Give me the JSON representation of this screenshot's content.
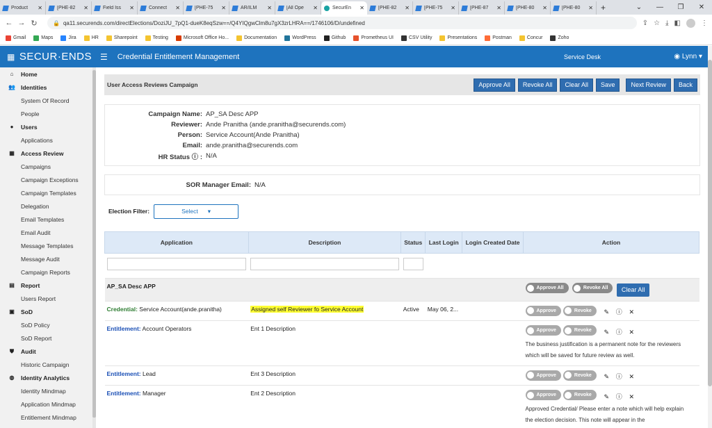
{
  "browser": {
    "tabs": [
      {
        "label": "Product"
      },
      {
        "label": "[PHE-82"
      },
      {
        "label": "Field Iss"
      },
      {
        "label": "Connect"
      },
      {
        "label": "[PHE-75"
      },
      {
        "label": "AR/ILM"
      },
      {
        "label": "[All Ope"
      },
      {
        "label": "SecurEn",
        "active": true
      },
      {
        "label": "[PHE-82"
      },
      {
        "label": "[PHE-75"
      },
      {
        "label": "[PHE-87"
      },
      {
        "label": "[PHE-80"
      },
      {
        "label": "[PHE-80"
      }
    ],
    "url": "qa11.securends.com/directElections/DoziJU_7pQ1-dueK8eqSzw==/Q4YIQgwClm8u7gX3zrLHRA==/1746106/D/undefined",
    "bookmarks": [
      {
        "label": "Gmail",
        "color": "#ea4335"
      },
      {
        "label": "Maps",
        "color": "#34a853"
      },
      {
        "label": "Jira",
        "color": "#2684ff"
      },
      {
        "label": "HR",
        "color": "#f4c430"
      },
      {
        "label": "Sharepoint",
        "color": "#f4c430"
      },
      {
        "label": "Testing",
        "color": "#f4c430"
      },
      {
        "label": "Microsoft Office Ho...",
        "color": "#d83b01"
      },
      {
        "label": "Documentation",
        "color": "#f4c430"
      },
      {
        "label": "WordPress",
        "color": "#21759b"
      },
      {
        "label": "Github",
        "color": "#222222"
      },
      {
        "label": "Prometheus UI",
        "color": "#e6522c"
      },
      {
        "label": "CSV Utility",
        "color": "#333333"
      },
      {
        "label": "Presentations",
        "color": "#f4c430"
      },
      {
        "label": "Postman",
        "color": "#ff6c37"
      },
      {
        "label": "Concur",
        "color": "#f4c430"
      },
      {
        "label": "Zoho",
        "color": "#333333"
      }
    ]
  },
  "header": {
    "logo": "SECUR·ENDS",
    "title": "Credential Entitlement Management",
    "service_desk": "Service Desk",
    "user": "Lynn",
    "accent": "#1e73be"
  },
  "sidebar": {
    "items": [
      {
        "label": "Home",
        "level": "top",
        "icon": "home-icon"
      },
      {
        "label": "Identities",
        "level": "top",
        "icon": "identities-icon"
      },
      {
        "label": "System Of Record",
        "level": "sub"
      },
      {
        "label": "People",
        "level": "sub"
      },
      {
        "label": "Users",
        "level": "top",
        "icon": "user-icon"
      },
      {
        "label": "Applications",
        "level": "sub"
      },
      {
        "label": "Access Review",
        "level": "top",
        "icon": "grid-icon"
      },
      {
        "label": "Campaigns",
        "level": "sub"
      },
      {
        "label": "Campaign Exceptions",
        "level": "sub"
      },
      {
        "label": "Campaign Templates",
        "level": "sub"
      },
      {
        "label": "Delegation",
        "level": "sub"
      },
      {
        "label": "Email Templates",
        "level": "sub"
      },
      {
        "label": "Email Audit",
        "level": "sub"
      },
      {
        "label": "Message Templates",
        "level": "sub"
      },
      {
        "label": "Message Audit",
        "level": "sub"
      },
      {
        "label": "Campaign Reports",
        "level": "sub"
      },
      {
        "label": "Report",
        "level": "top",
        "icon": "report-icon"
      },
      {
        "label": "Users Report",
        "level": "sub"
      },
      {
        "label": "SoD",
        "level": "top",
        "icon": "sod-icon"
      },
      {
        "label": "SoD Policy",
        "level": "sub"
      },
      {
        "label": "SoD Report",
        "level": "sub"
      },
      {
        "label": "Audit",
        "level": "top",
        "icon": "shield-icon"
      },
      {
        "label": "Historic Campaign",
        "level": "sub"
      },
      {
        "label": "Identity Analytics",
        "level": "top",
        "icon": "analytics-icon"
      },
      {
        "label": "Identity Mindmap",
        "level": "sub"
      },
      {
        "label": "Application Mindmap",
        "level": "sub"
      },
      {
        "label": "Entitlement Mindmap",
        "level": "sub"
      }
    ]
  },
  "toolbar": {
    "title": "User Access Reviews Campaign",
    "buttons": [
      "Approve All",
      "Revoke All",
      "Clear All",
      "Save",
      "Next Review",
      "Back"
    ]
  },
  "info": {
    "campaign_name_label": "Campaign Name:",
    "campaign_name": "AP_SA Desc APP",
    "reviewer_label": "Reviewer:",
    "reviewer": "Ande Pranitha (ande.pranitha@securends.com)",
    "person_label": "Person:",
    "person": "Service Account(Ande Pranitha)",
    "email_label": "Email:",
    "email": "ande.pranitha@securends.com",
    "hr_status_label": "HR Status",
    "hr_status": "N/A",
    "sor_label": "SOR Manager Email:",
    "sor_value": "N/A"
  },
  "filter": {
    "label": "Election Filter:",
    "value": "Select"
  },
  "table": {
    "columns": [
      "Application",
      "Description",
      "Status",
      "Last Login",
      "Login Created Date",
      "Action"
    ],
    "group": {
      "name": "AP_SA Desc APP",
      "approve_all": "Approve All",
      "revoke_all": "Revoke All",
      "clear_all": "Clear All"
    },
    "approve": "Approve",
    "revoke": "Revoke",
    "rows": [
      {
        "type": "Credential:",
        "name": "Service Account(ande.pranitha)",
        "description": "Assigned self Reviewer fo Service Account",
        "status": "Active",
        "last_login": "May 06, 2...",
        "note": ""
      },
      {
        "type": "Entitlement:",
        "name": "Account Operators",
        "description": "Ent 1 Description",
        "status": "",
        "last_login": "",
        "note": "The business justification is a permanent note for the reviewers which will be saved for future review as well."
      },
      {
        "type": "Entitlement:",
        "name": "Lead",
        "description": "Ent 3 Description",
        "status": "",
        "last_login": "",
        "note": ""
      },
      {
        "type": "Entitlement:",
        "name": "Manager",
        "description": "Ent 2 Description",
        "status": "",
        "last_login": "",
        "note": "Approved Credential/ Please enter a note which will help explain the election decision. This note will appear in the"
      }
    ]
  }
}
